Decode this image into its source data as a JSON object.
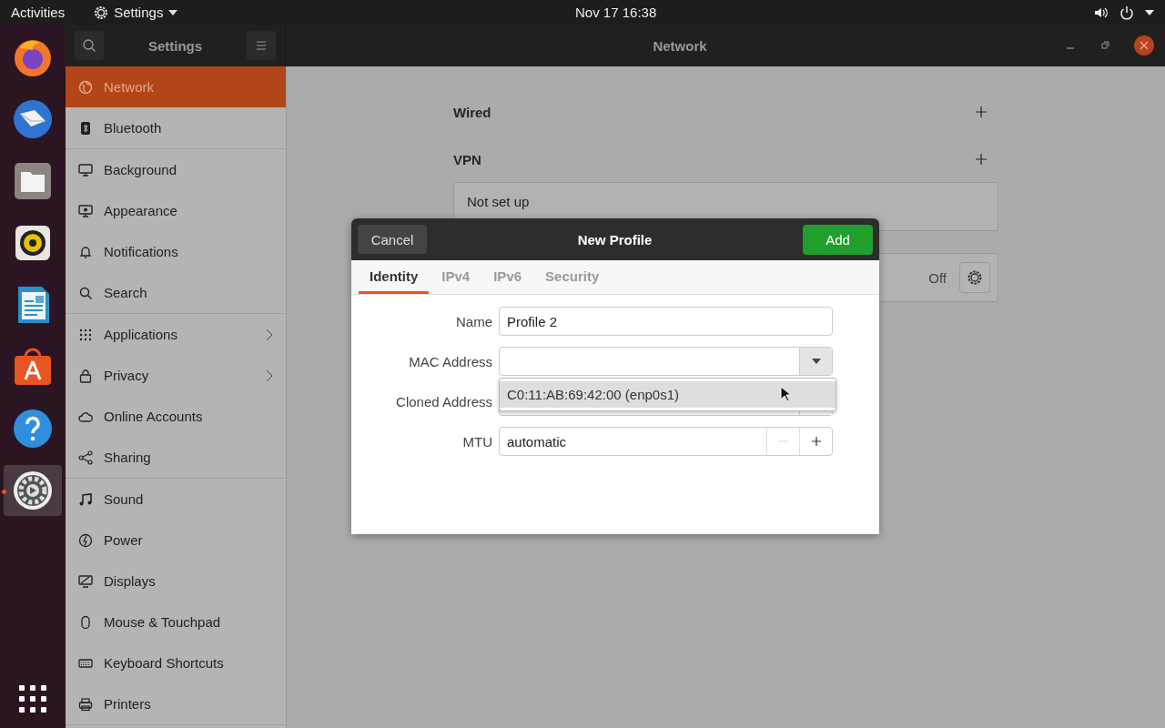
{
  "top_bar": {
    "activities": "Activities",
    "app_menu": "Settings",
    "clock": "Nov 17  16:38"
  },
  "dock": [
    {
      "selected": false
    },
    {
      "selected": false
    },
    {
      "selected": false
    },
    {
      "selected": false
    },
    {
      "selected": false
    },
    {
      "selected": false
    },
    {
      "selected": false
    },
    {
      "selected": true
    }
  ],
  "window": {
    "sidebar_title": "Settings",
    "page_title": "Network"
  },
  "sidebar": {
    "sections": [
      {
        "items": [
          {
            "label": "Network",
            "selected": true,
            "submenu": false
          },
          {
            "label": "Bluetooth",
            "selected": false,
            "submenu": false
          }
        ]
      },
      {
        "items": [
          {
            "label": "Background",
            "selected": false,
            "submenu": false
          },
          {
            "label": "Appearance",
            "selected": false,
            "submenu": false
          },
          {
            "label": "Notifications",
            "selected": false,
            "submenu": false
          },
          {
            "label": "Search",
            "selected": false,
            "submenu": false
          }
        ]
      },
      {
        "items": [
          {
            "label": "Applications",
            "selected": false,
            "submenu": true
          },
          {
            "label": "Privacy",
            "selected": false,
            "submenu": true
          },
          {
            "label": "Online Accounts",
            "selected": false,
            "submenu": false
          },
          {
            "label": "Sharing",
            "selected": false,
            "submenu": false
          }
        ]
      },
      {
        "items": [
          {
            "label": "Sound",
            "selected": false,
            "submenu": false
          },
          {
            "label": "Power",
            "selected": false,
            "submenu": false
          },
          {
            "label": "Displays",
            "selected": false,
            "submenu": false
          },
          {
            "label": "Mouse & Touchpad",
            "selected": false,
            "submenu": false
          },
          {
            "label": "Keyboard Shortcuts",
            "selected": false,
            "submenu": false
          },
          {
            "label": "Printers",
            "selected": false,
            "submenu": false
          }
        ]
      }
    ]
  },
  "network": {
    "sections": [
      {
        "title": "Wired"
      },
      {
        "title": "VPN",
        "card": "Not set up"
      }
    ],
    "proxy": {
      "status": "Off"
    }
  },
  "dialog": {
    "cancel": "Cancel",
    "title": "New Profile",
    "add": "Add",
    "tabs": [
      {
        "label": "Identity",
        "selected": true
      },
      {
        "label": "IPv4",
        "selected": false
      },
      {
        "label": "IPv6",
        "selected": false
      },
      {
        "label": "Security",
        "selected": false
      }
    ],
    "fields": [
      {
        "label": "Name",
        "kind": "text",
        "value": "Profile 2"
      },
      {
        "label": "MAC Address",
        "kind": "combo",
        "expanded": true,
        "options": [
          {
            "label": "C0:11:AB:69:42:00 (enp0s1)",
            "selected": true
          }
        ]
      },
      {
        "label": "Cloned Address",
        "kind": "combo"
      },
      {
        "label": "MTU",
        "kind": "spin",
        "value": "automatic",
        "minus_disabled": true
      }
    ]
  }
}
